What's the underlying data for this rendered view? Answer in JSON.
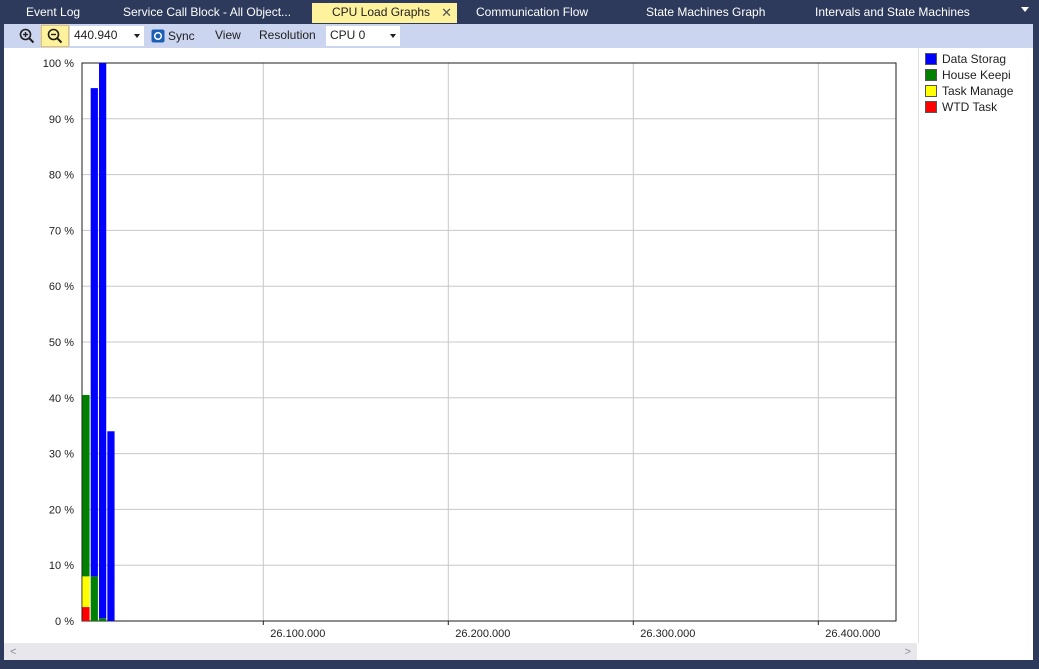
{
  "tabs": [
    {
      "label": "Event Log",
      "active": false
    },
    {
      "label": "Service Call Block - All Object...",
      "active": false
    },
    {
      "label": "CPU Load Graphs",
      "active": true
    },
    {
      "label": "Communication Flow",
      "active": false
    },
    {
      "label": "State Machines Graph",
      "active": false
    },
    {
      "label": "Intervals and State Machines",
      "active": false
    }
  ],
  "toolbar": {
    "zoom_value": "440.940",
    "sync_label": "Sync",
    "view_label": "View",
    "resolution_label": "Resolution",
    "cpu_value": "CPU 0",
    "icons": [
      "zoom-in-icon",
      "zoom-out-icon",
      "sync-icon",
      "chevron-down-icon"
    ]
  },
  "colors": {
    "tab_strip": "#2d3a5c",
    "active_tab": "#fff29d",
    "toolbar": "#ccd5f0"
  },
  "chart_data": {
    "type": "bar",
    "stacked": true,
    "y_tick_labels": [
      "0 %",
      "10 %",
      "20 %",
      "30 %",
      "40 %",
      "50 %",
      "60 %",
      "70 %",
      "80 %",
      "90 %",
      "100 %"
    ],
    "ylim": [
      0,
      100
    ],
    "x_tick_labels": [
      "26.100.000",
      "26.200.000",
      "26.300.000",
      "26.400.000"
    ],
    "xlim": [
      26002000,
      26442000
    ],
    "x_ticks": [
      26100000,
      26200000,
      26300000,
      26400000
    ],
    "grid": true,
    "legend_position": "right",
    "series": [
      {
        "name": "Data Storag",
        "color": "#0000ff"
      },
      {
        "name": "House Keepi",
        "color": "#008000"
      },
      {
        "name": "Task Manage",
        "color": "#ffff00"
      },
      {
        "name": "WTD Task",
        "color": "#ff0000"
      }
    ],
    "bars": [
      {
        "x": 26002200,
        "values": [
          0,
          32.5,
          5.5,
          2.5
        ]
      },
      {
        "x": 26006700,
        "values": [
          87.5,
          8.0,
          0,
          0
        ]
      },
      {
        "x": 26011200,
        "values": [
          99.5,
          0.5,
          0,
          0
        ]
      },
      {
        "x": 26015700,
        "values": [
          34.0,
          0,
          0,
          0
        ]
      }
    ],
    "bar_width_x": 3900
  }
}
